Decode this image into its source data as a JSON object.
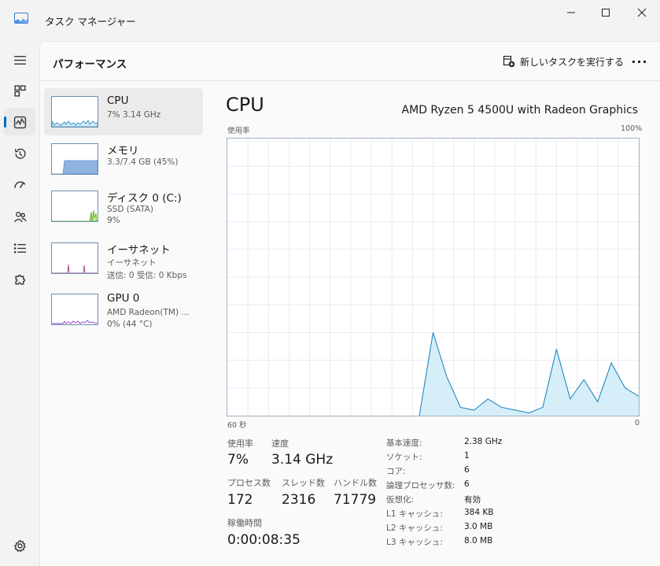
{
  "window": {
    "title": "タスク マネージャー"
  },
  "header": {
    "page_title": "パフォーマンス",
    "run_task_label": "新しいタスクを実行する",
    "more_label": "···"
  },
  "resources": [
    {
      "name": "CPU",
      "line1": "7%  3.14 GHz",
      "line2": ""
    },
    {
      "name": "メモリ",
      "line1": "3.3/7.4 GB (45%)",
      "line2": ""
    },
    {
      "name": "ディスク 0 (C:)",
      "line1": "SSD (SATA)",
      "line2": "9%"
    },
    {
      "name": "イーサネット",
      "line1": "イーサネット",
      "line2": "送信: 0 受信: 0 Kbps"
    },
    {
      "name": "GPU 0",
      "line1": "AMD Radeon(TM) ...",
      "line2": "0%  (44 °C)"
    }
  ],
  "detail": {
    "title": "CPU",
    "model": "AMD Ryzen 5 4500U with Radeon Graphics",
    "graph_ylabel": "使用率",
    "graph_ymax": "100%",
    "graph_xleft": "60 秒",
    "graph_xright": "0",
    "stats": {
      "usage_label": "使用率",
      "usage_value": "7%",
      "speed_label": "速度",
      "speed_value": "3.14 GHz",
      "processes_label": "プロセス数",
      "processes_value": "172",
      "threads_label": "スレッド数",
      "threads_value": "2316",
      "handles_label": "ハンドル数",
      "handles_value": "71779",
      "uptime_label": "稼働時間",
      "uptime_value": "0:00:08:35"
    },
    "specs": [
      {
        "label": "基本速度:",
        "value": "2.38 GHz"
      },
      {
        "label": "ソケット:",
        "value": "1"
      },
      {
        "label": "コア:",
        "value": "6"
      },
      {
        "label": "論理プロセッサ数:",
        "value": "6"
      },
      {
        "label": "仮想化:",
        "value": "有効"
      },
      {
        "label": "L1 キャッシュ:",
        "value": "384 KB"
      },
      {
        "label": "L2 キャッシュ:",
        "value": "3.0 MB"
      },
      {
        "label": "L3 キャッシュ:",
        "value": "8.0 MB"
      }
    ]
  },
  "colors": {
    "accent": "#0067c0",
    "cpu_line": "#117dbb",
    "cpu_fill": "#d5eef8",
    "memory_fill": "#90b4e0",
    "disk_line": "#4da60c",
    "ethernet_line": "#a74f8c",
    "gpu_line": "#8e3fd1"
  },
  "chart_data": {
    "type": "area",
    "x": [
      60,
      58,
      56,
      54,
      52,
      50,
      48,
      46,
      44,
      42,
      40,
      38,
      36,
      34,
      32,
      30,
      28,
      26,
      24,
      22,
      20,
      18,
      16,
      14,
      12,
      10,
      8,
      6,
      4,
      2,
      0
    ],
    "values": [
      0,
      0,
      0,
      0,
      0,
      0,
      0,
      0,
      0,
      0,
      0,
      0,
      0,
      0,
      0,
      30,
      14,
      3,
      2,
      6,
      3,
      2,
      1,
      3,
      24,
      6,
      13,
      5,
      19,
      10,
      7
    ],
    "xlabel": "",
    "ylabel": "使用率",
    "ylim": [
      0,
      100
    ],
    "grid": true
  }
}
